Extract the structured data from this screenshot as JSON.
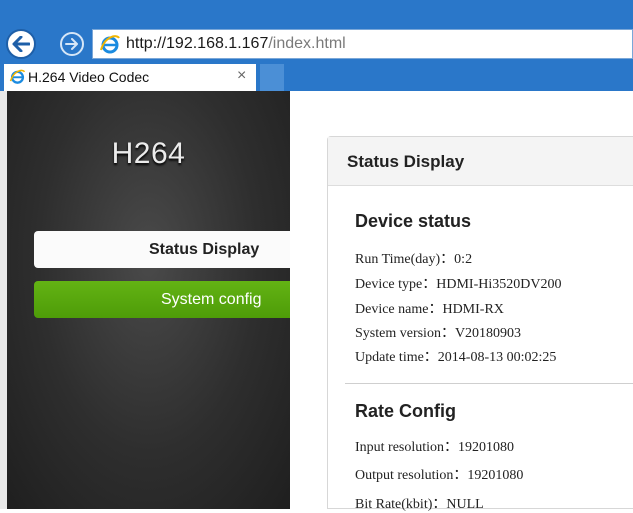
{
  "browser": {
    "url_main": "http://192.168.1.167",
    "url_path": "/index.html",
    "tab_title": "H.264 Video Codec",
    "tab_close": "×",
    "icons": {
      "back": "back-arrow-icon",
      "forward": "forward-arrow-icon",
      "site": "ie-icon"
    }
  },
  "sidebar": {
    "logo": "H264",
    "items": [
      {
        "label": "Status Display",
        "active": true
      },
      {
        "label": "System config",
        "active": false
      }
    ]
  },
  "panel": {
    "title": "Status Display",
    "device_status": {
      "title": "Device status",
      "rows": [
        "Run Time(day)：0:2",
        "Device type：HDMI-Hi3520DV200",
        "Device name：HDMI-RX",
        "System version：V20180903",
        "Update time：2014-08-13 00:02:25"
      ]
    },
    "rate_config": {
      "title": "Rate Config",
      "rows": [
        "Input resolution：19201080",
        "Output resolution：19201080",
        "Bit Rate(kbit)：NULL"
      ]
    }
  },
  "colors": {
    "chrome": "#2a77c9",
    "accent_green": "#5aa80e",
    "sidebar_bg": "#2e2e2e"
  }
}
